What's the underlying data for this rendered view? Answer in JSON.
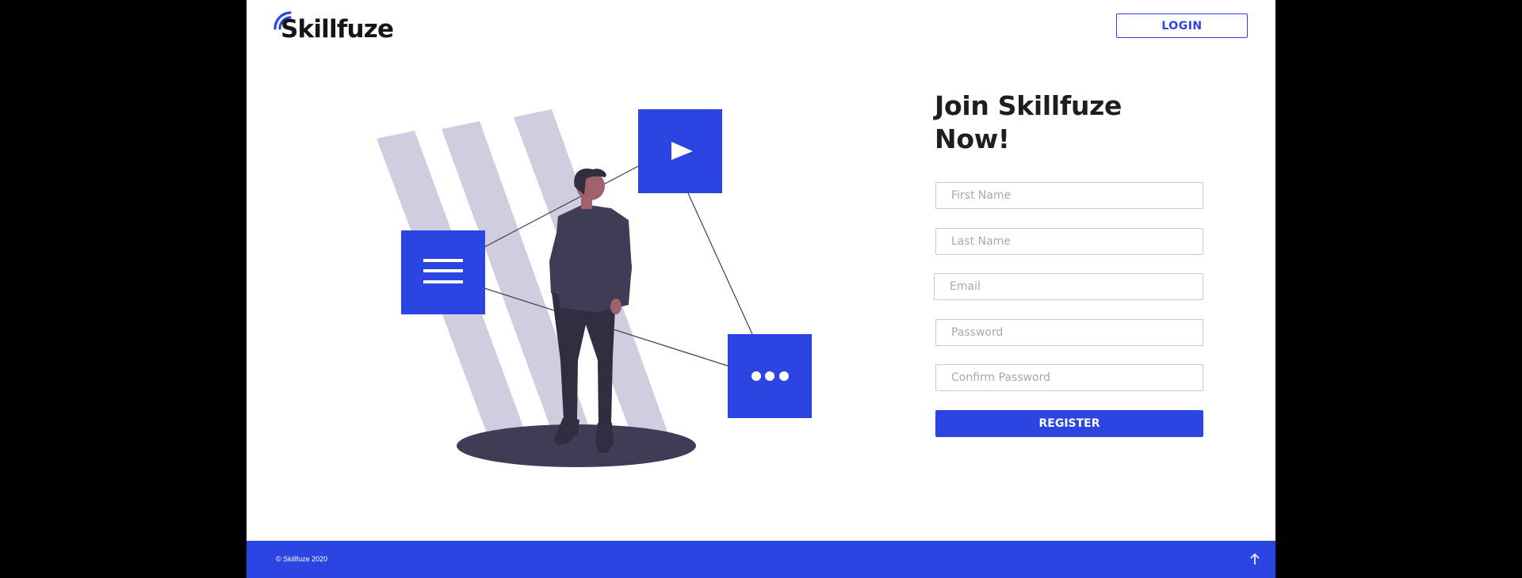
{
  "header": {
    "logo_text": "Skillfuze",
    "login_label": "LOGIN"
  },
  "illustration": {
    "icons": [
      "menu-icon",
      "play-icon",
      "more-icon"
    ]
  },
  "form": {
    "title_line1": "Join Skillfuze",
    "title_line2": "Now!",
    "first_name_placeholder": "First Name",
    "last_name_placeholder": "Last Name",
    "email_placeholder": "Email",
    "password_placeholder": "Password",
    "confirm_password_placeholder": "Confirm Password",
    "register_label": "REGISTER"
  },
  "footer": {
    "copyright": "© Skillfuze 2020"
  },
  "colors": {
    "brand_blue": "#2b45e2",
    "stripe": "#d0cde1",
    "figure_dark": "#3f3d56",
    "skin": "#a0616a",
    "frame_black": "#000000"
  }
}
